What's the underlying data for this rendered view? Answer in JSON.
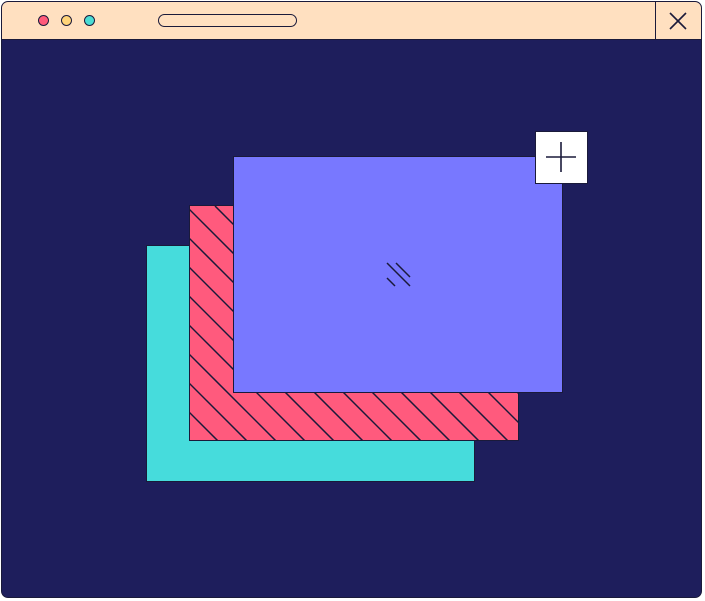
{
  "window": {
    "titlebar": {
      "traffic_lights": [
        "close-dot",
        "minimize-dot",
        "maximize-dot"
      ],
      "url_bar": {
        "value": ""
      },
      "close_icon": "close-icon"
    }
  },
  "colors": {
    "titlebar": "#ffe0c0",
    "background": "#1e1e5c",
    "outline": "#1a1a3a",
    "dot_red": "#ff5a7a",
    "dot_yellow": "#ffd479",
    "dot_teal": "#4adcd4",
    "card_back": "#46dcdc",
    "card_middle": "#ff5a7d",
    "card_front": "#7878ff",
    "add_button": "#ffffff"
  },
  "cards": [
    {
      "name": "card-back",
      "pattern": "solid"
    },
    {
      "name": "card-middle",
      "pattern": "diagonal-stripes"
    },
    {
      "name": "card-front",
      "pattern": "solid",
      "icon": "image-placeholder-icon"
    }
  ],
  "add_button": {
    "icon": "plus-icon"
  }
}
